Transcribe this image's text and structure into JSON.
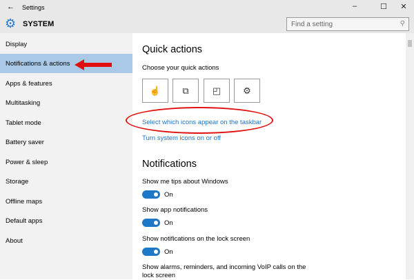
{
  "window": {
    "title": "Settings",
    "minimize": "–",
    "maximize": "☐",
    "close": "✕",
    "back": "←"
  },
  "header": {
    "section": "SYSTEM",
    "search_placeholder": "Find a setting"
  },
  "sidebar": {
    "items": [
      {
        "label": "Display"
      },
      {
        "label": "Notifications & actions",
        "selected": true
      },
      {
        "label": "Apps & features"
      },
      {
        "label": "Multitasking"
      },
      {
        "label": "Tablet mode"
      },
      {
        "label": "Battery saver"
      },
      {
        "label": "Power & sleep"
      },
      {
        "label": "Storage"
      },
      {
        "label": "Offline maps"
      },
      {
        "label": "Default apps"
      },
      {
        "label": "About"
      }
    ]
  },
  "main": {
    "quick_title": "Quick actions",
    "quick_sub": "Choose your quick actions",
    "quick_icons": [
      "tablet-mode-icon",
      "connect-icon",
      "note-icon",
      "settings-icon"
    ],
    "link_taskbar": "Select which icons appear on the taskbar",
    "link_system": "Turn system icons on or off",
    "notif_title": "Notifications",
    "settings": [
      {
        "label": "Show me tips about Windows",
        "state": "On"
      },
      {
        "label": "Show app notifications",
        "state": "On"
      },
      {
        "label": "Show notifications on the lock screen",
        "state": "On"
      },
      {
        "label": "Show alarms, reminders, and incoming VoIP calls on the lock screen"
      }
    ]
  },
  "colors": {
    "accent": "#1e78c8",
    "selected": "#a9c9e6",
    "annotation": "#e01010"
  }
}
